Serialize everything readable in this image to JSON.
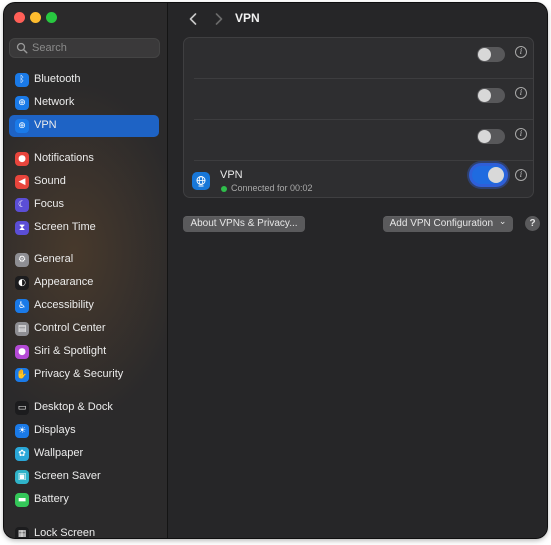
{
  "window": {
    "title": "VPN",
    "search_placeholder": "Search"
  },
  "sidebar": {
    "items": [
      {
        "label": "Bluetooth",
        "icon": "bluetooth-icon",
        "color": "#1a7ae8",
        "glyph": "ᛒ"
      },
      {
        "label": "Network",
        "icon": "globe-icon",
        "color": "#1a7ae8",
        "glyph": "⊕"
      },
      {
        "label": "VPN",
        "icon": "vpn-globe-icon",
        "color": "#1a7ae8",
        "glyph": "⊕"
      },
      {
        "label": "Notifications",
        "icon": "bell-icon",
        "color": "#e8453c",
        "glyph": "●"
      },
      {
        "label": "Sound",
        "icon": "speaker-icon",
        "color": "#e8453c",
        "glyph": "◀"
      },
      {
        "label": "Focus",
        "icon": "moon-icon",
        "color": "#5b4ed6",
        "glyph": "☾"
      },
      {
        "label": "Screen Time",
        "icon": "hourglass-icon",
        "color": "#5b4ed6",
        "glyph": "⧗"
      },
      {
        "label": "General",
        "icon": "gear-icon",
        "color": "#8e8e93",
        "glyph": "⚙"
      },
      {
        "label": "Appearance",
        "icon": "appearance-icon",
        "color": "#1c1c1e",
        "glyph": "◐"
      },
      {
        "label": "Accessibility",
        "icon": "accessibility-icon",
        "color": "#1a7ae8",
        "glyph": "♿"
      },
      {
        "label": "Control Center",
        "icon": "control-center-icon",
        "color": "#8e8e93",
        "glyph": "▤"
      },
      {
        "label": "Siri & Spotlight",
        "icon": "siri-icon",
        "color": "#b44ad6",
        "glyph": "●"
      },
      {
        "label": "Privacy & Security",
        "icon": "hand-icon",
        "color": "#1a7ae8",
        "glyph": "✋"
      },
      {
        "label": "Desktop & Dock",
        "icon": "dock-icon",
        "color": "#1c1c1e",
        "glyph": "▭"
      },
      {
        "label": "Displays",
        "icon": "sun-icon",
        "color": "#1a7ae8",
        "glyph": "☀"
      },
      {
        "label": "Wallpaper",
        "icon": "wallpaper-icon",
        "color": "#2aa7d8",
        "glyph": "✿"
      },
      {
        "label": "Screen Saver",
        "icon": "screen-saver-icon",
        "color": "#2fb3c9",
        "glyph": "▣"
      },
      {
        "label": "Battery",
        "icon": "battery-icon",
        "color": "#34c759",
        "glyph": "▬"
      },
      {
        "label": "Lock Screen",
        "icon": "lock-screen-icon",
        "color": "#1c1c1e",
        "glyph": "▦"
      }
    ],
    "active_index": 2
  },
  "vpn_panel": {
    "rows": [
      {
        "toggle_on": false
      },
      {
        "toggle_on": false
      },
      {
        "toggle_on": false
      },
      {
        "toggle_on": true,
        "name": "VPN",
        "status": "Connected for 00:02"
      }
    ]
  },
  "buttons": {
    "about": "About VPNs & Privacy...",
    "add": "Add VPN Configuration",
    "add_chevron": "⌄",
    "help": "?"
  },
  "colors": {
    "accent": "#1e63c5",
    "toggle_on": "#1f6be0",
    "connected": "#2fbe4b"
  }
}
